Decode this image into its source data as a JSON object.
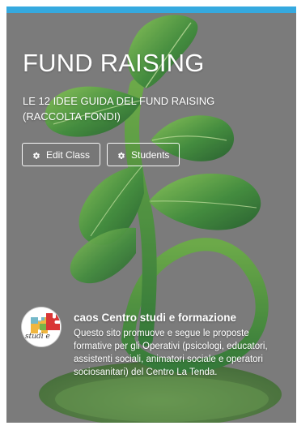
{
  "card": {
    "title": "FUND RAISING",
    "subtitle": "LE 12 IDEE GUIDA DEL FUND RAISING (RACCOLTA FONDI)",
    "buttons": {
      "edit_class_label": "Edit Class",
      "students_label": "Students"
    },
    "owner": {
      "name": "caos Centro studi e formazione",
      "description": "Questo sito promuove e segue le proposte formative per gli Operativi (psicologi, educatori, assistenti sociali, animatori sociale e operatori sociosanitari) del Centro La Tenda.",
      "avatar_text": "studi e"
    }
  },
  "colors": {
    "accent_top": "#35a9df",
    "card_bg": "#7b7b7b",
    "leaf": "#2f7d31",
    "leaf_light": "#78bb46",
    "text": "#ffffff"
  },
  "icons": {
    "button_icon": "gear-icon"
  }
}
